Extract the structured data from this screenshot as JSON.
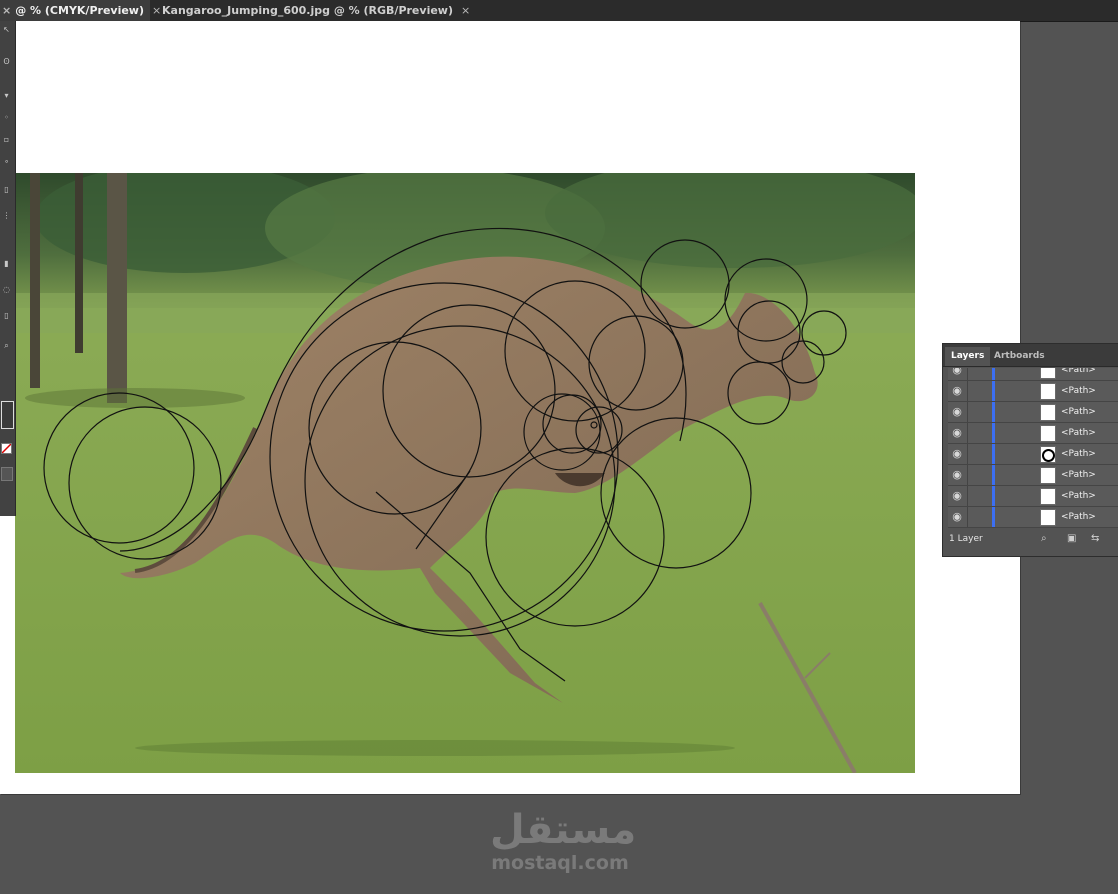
{
  "tabs": [
    {
      "label": "@ % (CMYK/Preview)",
      "close": "×",
      "active": true
    },
    {
      "label": "Kangaroo_Jumping_600.jpg @ % (RGB/Preview)",
      "close": "×",
      "active": false
    }
  ],
  "tools": [
    "arrow-icon",
    "lasso-icon",
    "pen-icon",
    "type-icon",
    "rect-icon",
    "brush-icon",
    "rotate-icon",
    "scale-icon",
    "graph-icon",
    "mesh-icon",
    "eyedropper-icon",
    "zoom-icon",
    "fill-stroke-icon",
    "screen-mode-icon"
  ],
  "layers_panel": {
    "tabs": [
      "Layers",
      "Artboards"
    ],
    "rows": [
      "<Path>",
      "<Path>",
      "<Path>",
      "<Path>",
      "<Path>",
      "<Path>",
      "<Path>",
      "<Path>"
    ],
    "selected_thumb_index": 4,
    "layer_count": "1 Layer"
  },
  "watermark": {
    "arabic": "مستقل",
    "latin": "mostaql.com"
  },
  "colors": {
    "workspace": "#535353",
    "artboard": "#ffffff",
    "accent_blue": "#3c6ff2"
  }
}
